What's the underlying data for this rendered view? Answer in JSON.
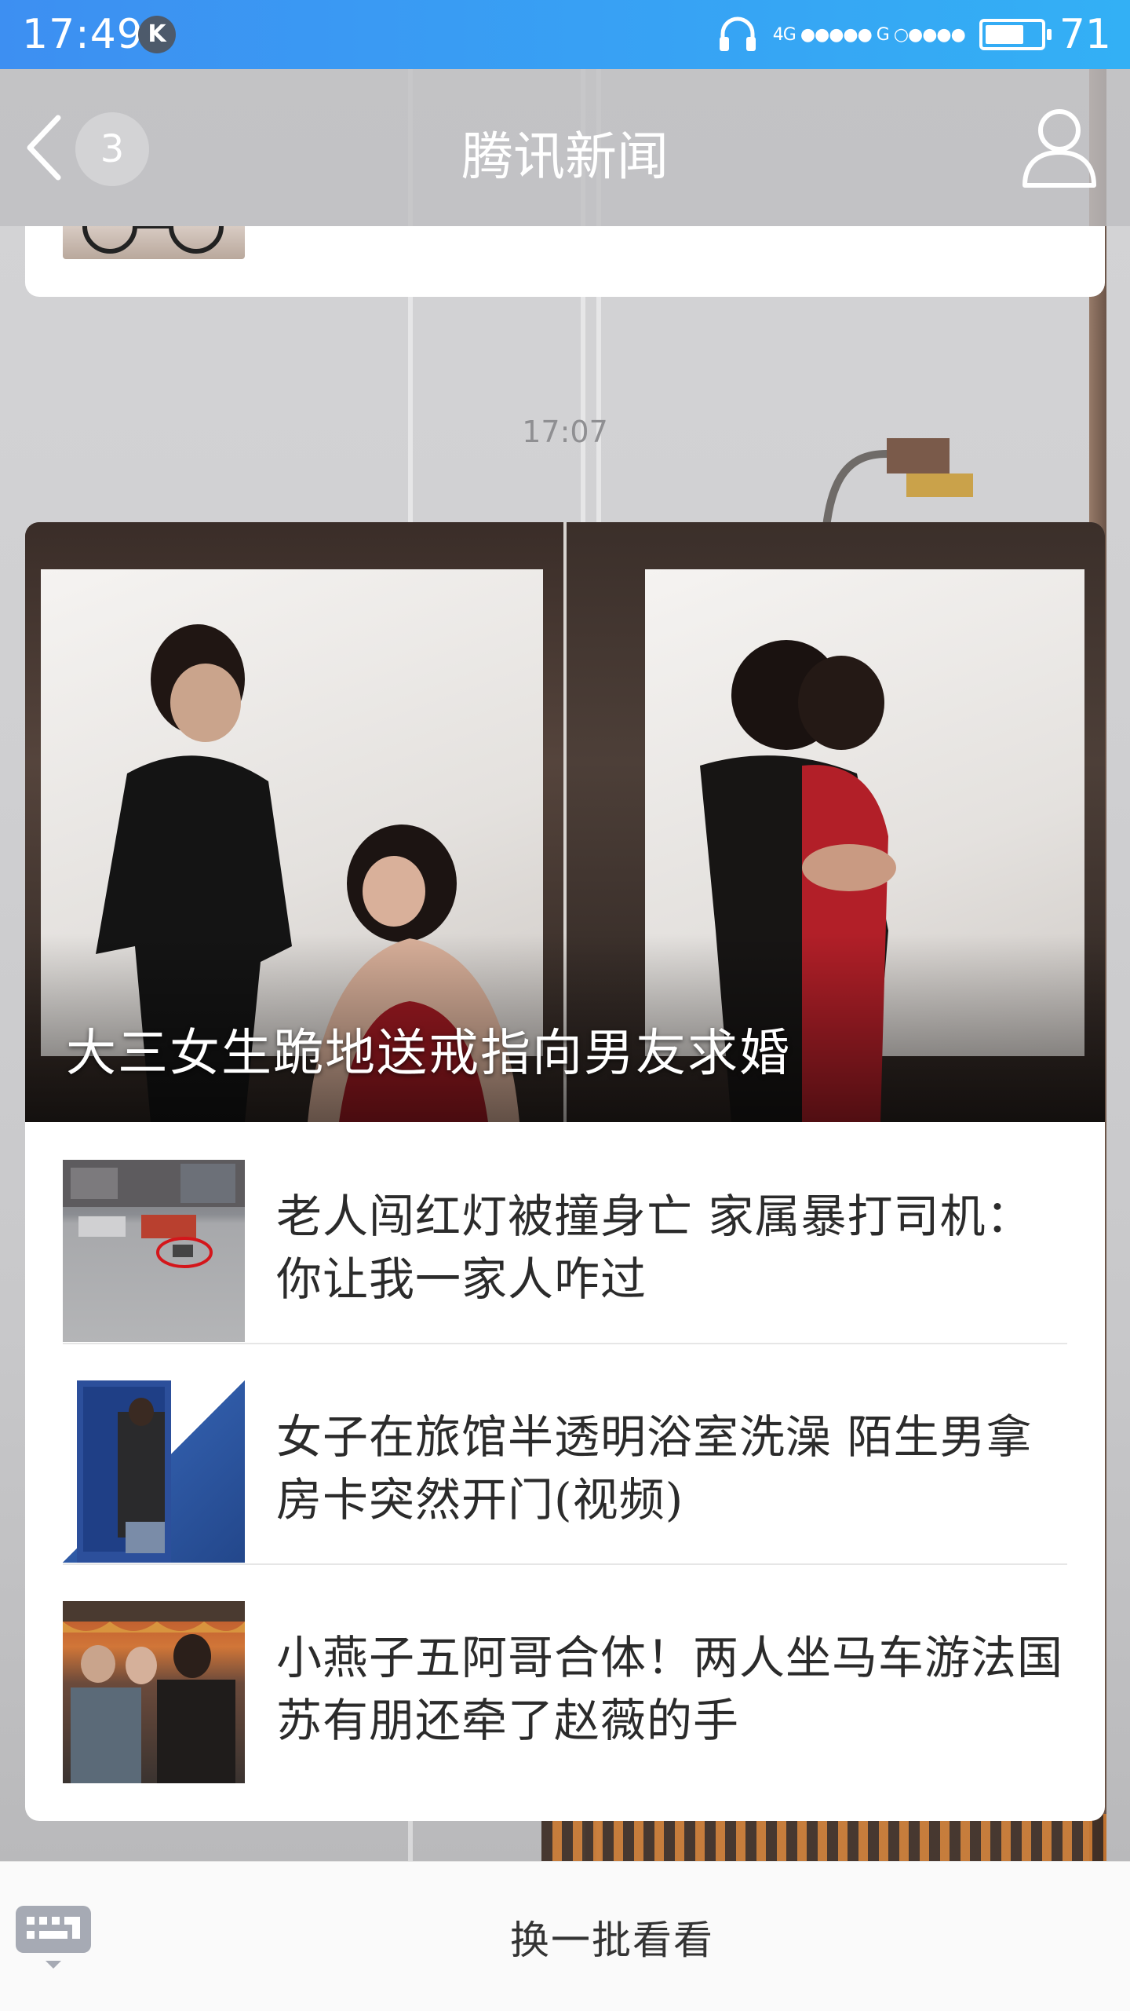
{
  "status_bar": {
    "time": "17:49",
    "k_badge": "K",
    "signal_text": "4G ●●●●●  G ○●●●●",
    "battery_level": "71",
    "battery_fraction": 0.71
  },
  "header": {
    "title": "腾讯新闻",
    "back_badge_count": "3",
    "icons": [
      "back-chevron-icon",
      "profile-icon"
    ]
  },
  "chat": {
    "timestamp": "17:07"
  },
  "news_card": {
    "hero_caption": "大三女生跪地送戒指向男友求婚",
    "items": [
      {
        "title": "老人闯红灯被撞身亡 家属暴打司机：你让我一家人咋过"
      },
      {
        "title": "女子在旅馆半透明浴室洗澡 陌生男拿房卡突然开门(视频)"
      },
      {
        "title": "小燕子五阿哥合体！两人坐马车游法国 苏有朋还牵了赵薇的手"
      }
    ]
  },
  "bottom_bar": {
    "refresh_label": "换一批看看",
    "icons": [
      "keyboard-toggle-icon"
    ]
  }
}
